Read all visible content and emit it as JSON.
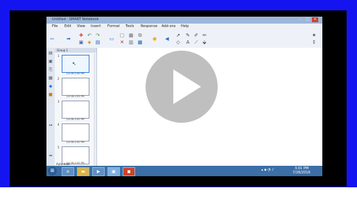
{
  "window": {
    "title": "Untitled - SMART Notebook",
    "controls": {
      "minimize": "–",
      "maximize": "□",
      "close": "×"
    }
  },
  "menu": {
    "items": [
      "File",
      "Edit",
      "View",
      "Insert",
      "Format",
      "Tools",
      "Response",
      "Add-ons",
      "Help"
    ]
  },
  "sorter": {
    "header": "Group 1",
    "pages": [
      {
        "number": "1",
        "time": "Jul 28-2:50 PM",
        "active": true
      },
      {
        "number": "2",
        "time": "Jul 28-2:53 PM",
        "active": false
      },
      {
        "number": "3",
        "time": "Jul 28-2:52 PM",
        "active": false
      },
      {
        "number": "4",
        "time": "Jul 28-2:52 PM",
        "active": false
      },
      {
        "number": "5",
        "time": "Jul 28-2:52 PM",
        "active": false
      }
    ],
    "auto_hide": "Auto-hide"
  },
  "taskbar": {
    "clock_time": "3:01 PM",
    "clock_date": "7/28/2016"
  },
  "video": {
    "play_icon": "play-icon"
  },
  "colors": {
    "frame": "#1414f0",
    "taskbar": "#3b6fa6",
    "play_overlay": "#aaaaaa"
  }
}
